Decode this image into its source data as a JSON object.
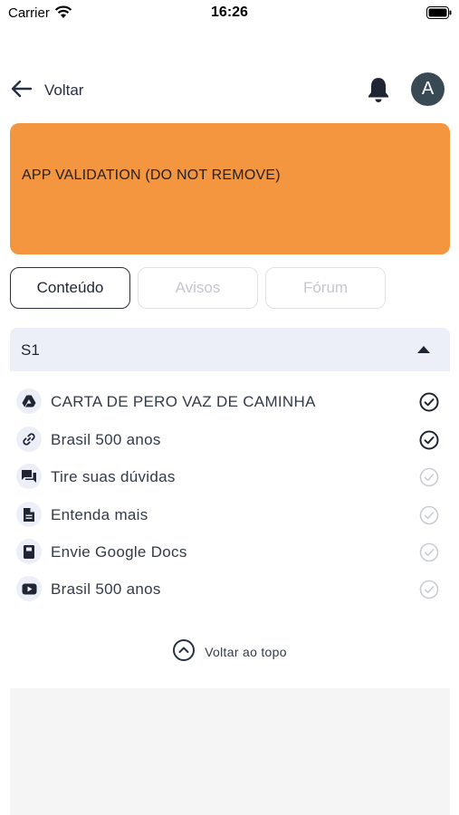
{
  "status_bar": {
    "carrier": "Carrier",
    "time": "16:26"
  },
  "header": {
    "back_label": "Voltar",
    "avatar_initial": "A"
  },
  "banner": {
    "text": "APP VALIDATION (DO NOT REMOVE)",
    "color": "#f4953f"
  },
  "tabs": [
    {
      "label": "Conteúdo",
      "active": true
    },
    {
      "label": "Avisos",
      "active": false
    },
    {
      "label": "Fórum",
      "active": false
    }
  ],
  "section": {
    "title": "S1",
    "expanded": true,
    "items": [
      {
        "label": "CARTA DE PERO VAZ DE CAMINHA",
        "icon": "google-drive-icon",
        "completed": true
      },
      {
        "label": "Brasil 500 anos",
        "icon": "link-icon",
        "completed": true
      },
      {
        "label": "Tire suas dúvidas",
        "icon": "forum-icon",
        "completed": false
      },
      {
        "label": "Entenda mais",
        "icon": "document-icon",
        "completed": false
      },
      {
        "label": "Envie Google Docs",
        "icon": "book-icon",
        "completed": false
      },
      {
        "label": "Brasil 500 anos",
        "icon": "youtube-icon",
        "completed": false
      }
    ]
  },
  "back_to_top_label": "Voltar ao topo"
}
